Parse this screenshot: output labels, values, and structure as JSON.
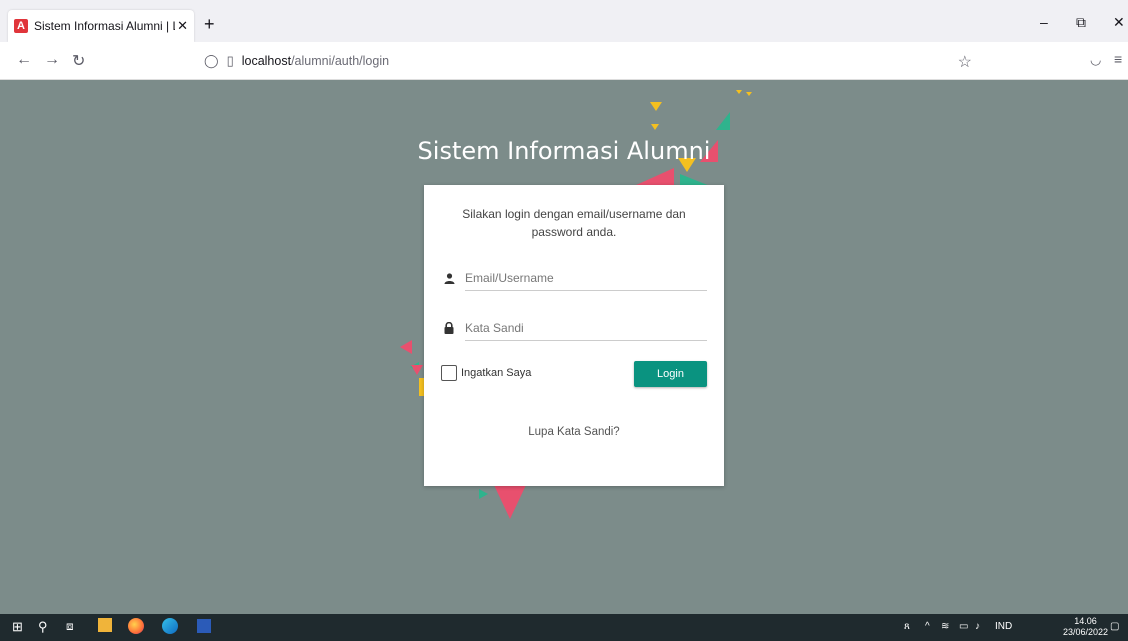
{
  "browser": {
    "tab_title": "Sistem Informasi Alumni | Login",
    "tab_favicon": "A",
    "url_host": "localhost",
    "url_path": "/alumni/auth/login"
  },
  "page": {
    "title": "Sistem Informasi Alumni",
    "intro": "Silakan login dengan email/username dan password anda.",
    "email_placeholder": "Email/Username",
    "password_placeholder": "Kata Sandi",
    "remember_label": "Ingatkan Saya",
    "login_label": "Login",
    "forgot_label": "Lupa Kata Sandi?",
    "colors": {
      "background": "#7c8c8a",
      "button": "#0a9380"
    }
  },
  "taskbar": {
    "language": "IND",
    "time": "14.06",
    "date": "23/06/2022"
  }
}
